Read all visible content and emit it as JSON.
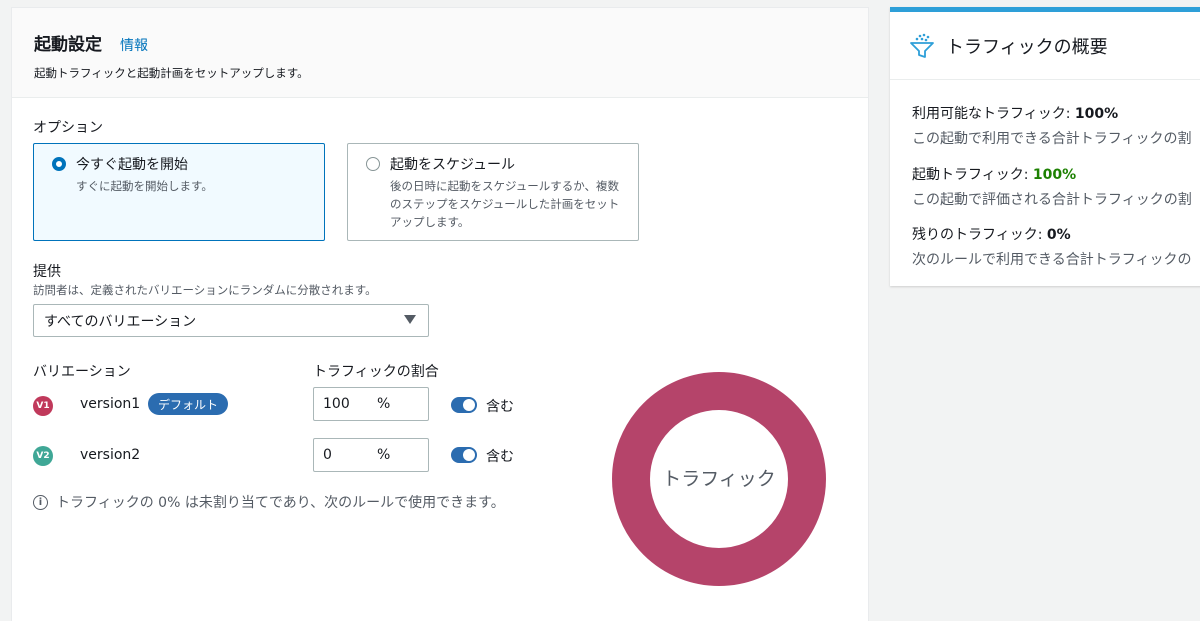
{
  "header": {
    "title": "起動設定",
    "info_link": "情報",
    "description": "起動トラフィックと起動計画をセットアップします。"
  },
  "options": {
    "label": "オプション",
    "items": [
      {
        "title": "今すぐ起動を開始",
        "description": "すぐに起動を開始します。",
        "selected": true
      },
      {
        "title": "起動をスケジュール",
        "description": "後の日時に起動をスケジュールするか、複数のステップをスケジュールした計画をセットアップします。",
        "selected": false
      }
    ]
  },
  "serve": {
    "label": "提供",
    "description": "訪問者は、定義されたバリエーションにランダムに分散されます。",
    "selected": "すべてのバリエーション"
  },
  "variations": {
    "col_variation": "バリエーション",
    "col_traffic": "トラフィックの割合",
    "rows": [
      {
        "badge": "V1",
        "name": "version1",
        "tag": "デフォルト",
        "value": "100",
        "unit": "%",
        "toggle_label": "含む",
        "color": "#c0395b"
      },
      {
        "badge": "V2",
        "name": "version2",
        "tag": "",
        "value": "0",
        "unit": "%",
        "toggle_label": "含む",
        "color": "#3fa796"
      }
    ],
    "note": "トラフィックの 0% は未割り当てであり、次のルールで使用できます。"
  },
  "chart_data": {
    "type": "pie",
    "center_label": "トラフィック",
    "categories": [
      "version1",
      "version2"
    ],
    "values": [
      100,
      0
    ],
    "colors": [
      "#b5446a",
      "#3fa796"
    ]
  },
  "summary": {
    "title": "トラフィックの概要",
    "items": [
      {
        "label": "利用可能なトラフィック: ",
        "value": "100%",
        "description": "この起動で利用できる合計トラフィックの割"
      },
      {
        "label": "起動トラフィック: ",
        "value": "100%",
        "description": "この起動で評価される合計トラフィックの割"
      },
      {
        "label": "残りのトラフィック: ",
        "value": "0%",
        "description": "次のルールで利用できる合計トラフィックの"
      }
    ]
  }
}
